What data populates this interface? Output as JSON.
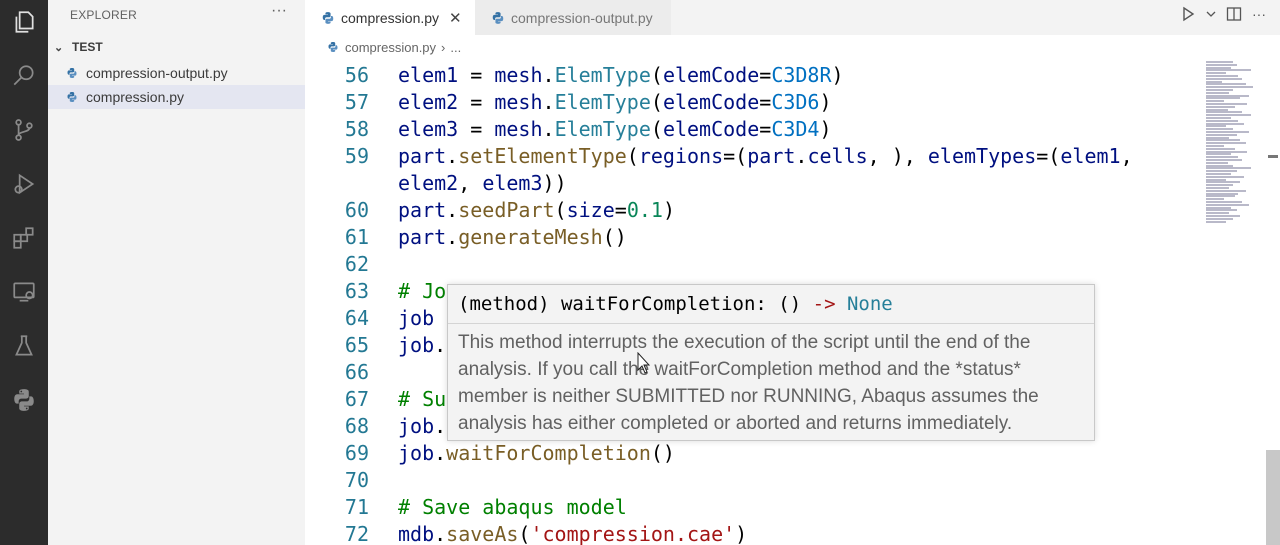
{
  "sidebar": {
    "title": "EXPLORER",
    "more": "···",
    "folder": "TEST",
    "files": [
      "compression-output.py",
      "compression.py"
    ]
  },
  "tabs": {
    "active": "compression.py",
    "inactive": "compression-output.py",
    "close": "✕"
  },
  "breadcrumb": {
    "file": "compression.py",
    "sep": "›",
    "rest": "..."
  },
  "editor": {
    "lines": [
      {
        "n": "56",
        "tokens": [
          [
            "t-var",
            "elem1"
          ],
          [
            "t-op",
            " = "
          ],
          [
            "t-var",
            "mesh"
          ],
          [
            "t-op",
            "."
          ],
          [
            "t-type",
            "ElemType"
          ],
          [
            "t-op",
            "("
          ],
          [
            "t-var",
            "elemCode"
          ],
          [
            "t-op",
            "="
          ],
          [
            "t-const",
            "C3D8R"
          ],
          [
            "t-op",
            ")"
          ]
        ]
      },
      {
        "n": "57",
        "tokens": [
          [
            "t-var",
            "elem2"
          ],
          [
            "t-op",
            " = "
          ],
          [
            "t-var",
            "mesh"
          ],
          [
            "t-op",
            "."
          ],
          [
            "t-type",
            "ElemType"
          ],
          [
            "t-op",
            "("
          ],
          [
            "t-var",
            "elemCode"
          ],
          [
            "t-op",
            "="
          ],
          [
            "t-const",
            "C3D6"
          ],
          [
            "t-op",
            ")"
          ]
        ]
      },
      {
        "n": "58",
        "tokens": [
          [
            "t-var",
            "elem3"
          ],
          [
            "t-op",
            " = "
          ],
          [
            "t-var",
            "mesh"
          ],
          [
            "t-op",
            "."
          ],
          [
            "t-type",
            "ElemType"
          ],
          [
            "t-op",
            "("
          ],
          [
            "t-var",
            "elemCode"
          ],
          [
            "t-op",
            "="
          ],
          [
            "t-const",
            "C3D4"
          ],
          [
            "t-op",
            ")"
          ]
        ]
      },
      {
        "n": "59",
        "tokens": [
          [
            "t-var",
            "part"
          ],
          [
            "t-op",
            "."
          ],
          [
            "t-fn",
            "setElementType"
          ],
          [
            "t-op",
            "("
          ],
          [
            "t-var",
            "regions"
          ],
          [
            "t-op",
            "=("
          ],
          [
            "t-var",
            "part"
          ],
          [
            "t-op",
            "."
          ],
          [
            "t-var",
            "cells"
          ],
          [
            "t-op",
            ", ), "
          ],
          [
            "t-var",
            "elemTypes"
          ],
          [
            "t-op",
            "=("
          ],
          [
            "t-var",
            "elem1"
          ],
          [
            "t-op",
            ","
          ]
        ]
      },
      {
        "n": "",
        "tokens": [
          [
            "t-var",
            "elem2"
          ],
          [
            "t-op",
            ", "
          ],
          [
            "t-var",
            "elem3"
          ],
          [
            "t-op",
            "))"
          ]
        ]
      },
      {
        "n": "60",
        "tokens": [
          [
            "t-var",
            "part"
          ],
          [
            "t-op",
            "."
          ],
          [
            "t-fn",
            "seedPart"
          ],
          [
            "t-op",
            "("
          ],
          [
            "t-var",
            "size"
          ],
          [
            "t-op",
            "="
          ],
          [
            "t-num",
            "0.1"
          ],
          [
            "t-op",
            ")"
          ]
        ]
      },
      {
        "n": "61",
        "tokens": [
          [
            "t-var",
            "part"
          ],
          [
            "t-op",
            "."
          ],
          [
            "t-fn",
            "generateMesh"
          ],
          [
            "t-op",
            "()"
          ]
        ]
      },
      {
        "n": "62",
        "tokens": []
      },
      {
        "n": "63",
        "tokens": [
          [
            "t-cmt",
            "# Jo"
          ]
        ]
      },
      {
        "n": "64",
        "tokens": [
          [
            "t-var",
            "job"
          ]
        ]
      },
      {
        "n": "65",
        "tokens": [
          [
            "t-var",
            "job"
          ],
          [
            "t-op",
            "."
          ]
        ]
      },
      {
        "n": "66",
        "tokens": []
      },
      {
        "n": "67",
        "tokens": [
          [
            "t-cmt",
            "# Su"
          ]
        ]
      },
      {
        "n": "68",
        "tokens": [
          [
            "t-var",
            "job"
          ],
          [
            "t-op",
            "."
          ]
        ]
      },
      {
        "n": "69",
        "tokens": [
          [
            "t-var",
            "job"
          ],
          [
            "t-op",
            "."
          ],
          [
            "t-fn",
            "waitForCompletion"
          ],
          [
            "t-op",
            "()"
          ]
        ]
      },
      {
        "n": "70",
        "tokens": []
      },
      {
        "n": "71",
        "tokens": [
          [
            "t-cmt",
            "# Save abaqus model"
          ]
        ]
      },
      {
        "n": "72",
        "tokens": [
          [
            "t-var",
            "mdb"
          ],
          [
            "t-op",
            "."
          ],
          [
            "t-fn",
            "saveAs"
          ],
          [
            "t-op",
            "("
          ],
          [
            "t-str",
            "'compression.cae'"
          ],
          [
            "t-op",
            ")"
          ]
        ]
      }
    ]
  },
  "hover": {
    "sig_kind": "(method) ",
    "sig_name": "waitForCompletion",
    "sig_rest": ": () ",
    "sig_arrow": "->",
    "sig_ret": " None",
    "doc": "This method interrupts the execution of the script until the end of the analysis. If you call the waitForCompletion method and the *status* member is neither SUBMITTED nor RUNNING, Abaqus assumes the analysis has either completed or aborted and returns immediately."
  }
}
